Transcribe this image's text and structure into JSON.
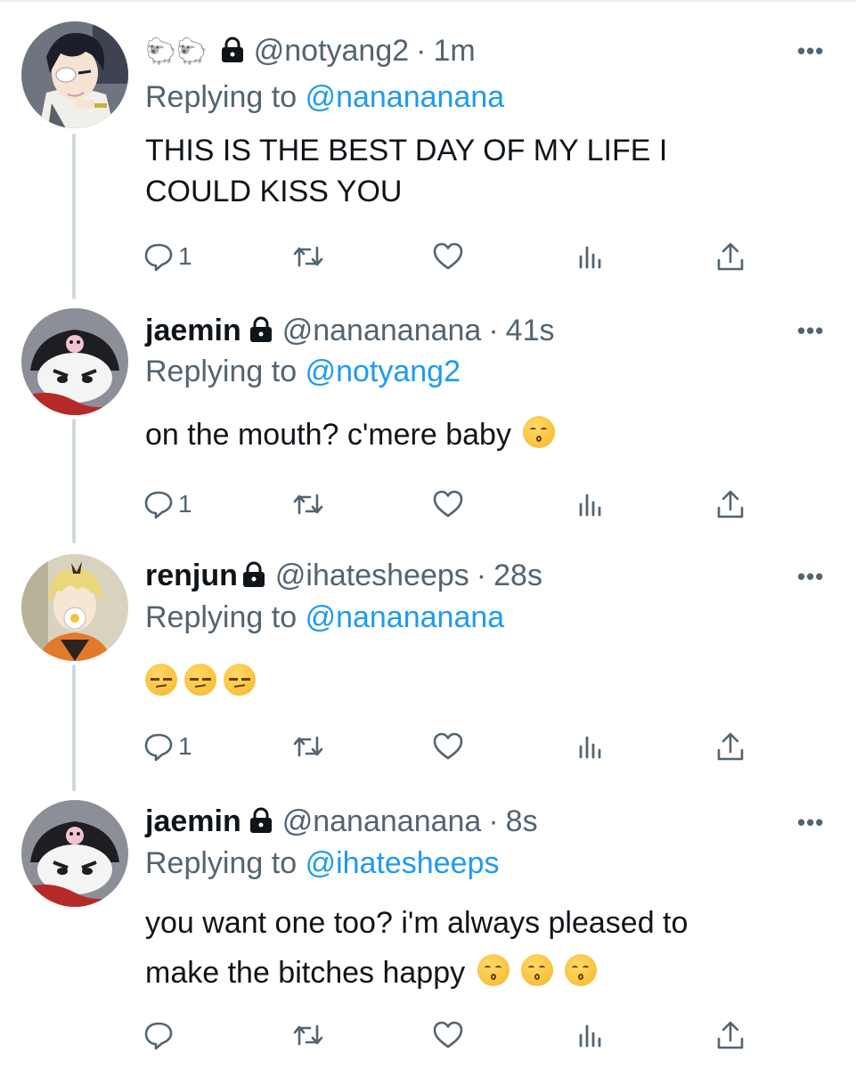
{
  "tweets": [
    {
      "name_emoji": "🐑🐑",
      "display_name": "",
      "handle": "@notyang2",
      "dot": "·",
      "time": "1m",
      "replying_label": "Replying to",
      "replying_handle": "@nanananana",
      "text": "THIS IS THE BEST DAY OF MY LIFE I COULD KISS YOU",
      "reply_count": "1",
      "avatar_icon": "anime-eyepatch-avatar"
    },
    {
      "display_name": "jaemin",
      "handle": "@nanananana",
      "dot": "·",
      "time": "41s",
      "replying_label": "Replying to",
      "replying_handle": "@notyang2",
      "text": "on the mouth? c'mere baby",
      "text_emoji_icons": [
        "kissing-face-icon"
      ],
      "reply_count": "1",
      "avatar_icon": "kuromi-avatar"
    },
    {
      "display_name": "renjun",
      "handle": "@ihatesheeps",
      "dot": "·",
      "time": "28s",
      "replying_label": "Replying to",
      "replying_handle": "@nanananana",
      "text": "",
      "text_emoji_icons": [
        "unamused-face-icon",
        "unamused-face-icon",
        "unamused-face-icon"
      ],
      "reply_count": "1",
      "avatar_icon": "anime-blonde-avatar"
    },
    {
      "display_name": "jaemin",
      "handle": "@nanananana",
      "dot": "·",
      "time": "8s",
      "replying_label": "Replying to",
      "replying_handle": "@ihatesheeps",
      "text_line1": "you want one too? i'm always pleased to",
      "text_line2": "make the bitches happy",
      "text_emoji_icons": [
        "kissing-face-icon",
        "kissing-face-icon",
        "kissing-face-icon"
      ],
      "reply_count": "",
      "avatar_icon": "kuromi-avatar"
    }
  ],
  "more_label": "•••",
  "colors": {
    "link": "#1d9bf0",
    "secondary": "#536471",
    "text": "#0f1419",
    "thread_line": "#cfd9de"
  },
  "action_icons": [
    "reply-icon",
    "retweet-icon",
    "like-icon",
    "analytics-icon",
    "share-icon"
  ]
}
